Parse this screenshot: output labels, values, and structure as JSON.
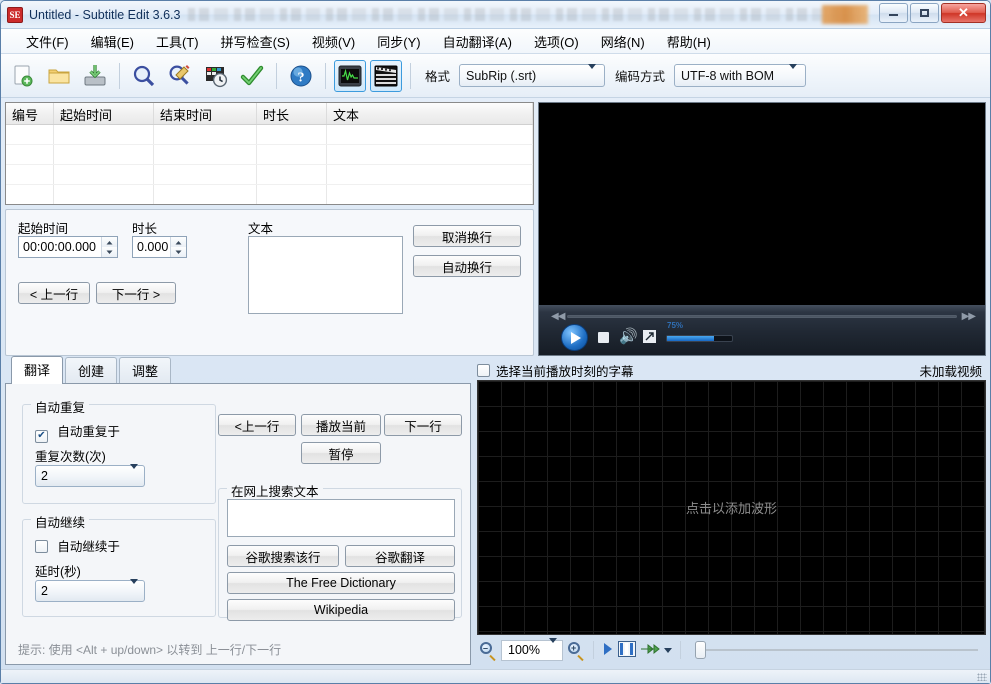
{
  "window": {
    "title": "Untitled - Subtitle Edit 3.6.3",
    "app_icon": "subtitle-edit-icon",
    "minimize": "–",
    "maximize": "□",
    "close": "✕"
  },
  "menu": [
    {
      "label": "文件(F)",
      "text": "文件",
      "key": "F"
    },
    {
      "label": "编辑(E)",
      "text": "编辑",
      "key": "E"
    },
    {
      "label": "工具(T)",
      "text": "工具",
      "key": "T"
    },
    {
      "label": "拼写检查(S)",
      "text": "拼写检查",
      "key": "S"
    },
    {
      "label": "视频(V)",
      "text": "视频",
      "key": "V"
    },
    {
      "label": "同步(Y)",
      "text": "同步",
      "key": "Y"
    },
    {
      "label": "自动翻译(A)",
      "text": "自动翻译",
      "key": "A"
    },
    {
      "label": "选项(O)",
      "text": "选项",
      "key": "O"
    },
    {
      "label": "网络(N)",
      "text": "网络",
      "key": "N"
    },
    {
      "label": "帮助(H)",
      "text": "帮助",
      "key": "H"
    }
  ],
  "toolbar": {
    "icons": [
      "new-file-icon",
      "open-folder-icon",
      "save-icon",
      "find-icon",
      "replace-icon",
      "sync-time-icon",
      "spell-check-icon",
      "help-icon",
      "waveform-toggle-icon",
      "video-toggle-icon"
    ],
    "format_label": "格式",
    "format_value": "SubRip (.srt)",
    "encoding_label": "编码方式",
    "encoding_value": "UTF-8 with BOM"
  },
  "list_view": {
    "columns": [
      "编号",
      "起始时间",
      "结束时间",
      "时长",
      "文本"
    ],
    "rows": []
  },
  "edit_panel": {
    "start_time_label": "起始时间",
    "start_time_value": "00:00:00.000",
    "duration_label": "时长",
    "duration_value": "0.000",
    "text_label": "文本",
    "text_value": "",
    "unbreak_button": "取消换行",
    "autobreak_button": "自动换行",
    "prev_button": "< 上一行",
    "next_button": "下一行 >"
  },
  "video": {
    "play_icon": "play-icon",
    "stop_icon": "stop-icon",
    "volume_icon": "volume-icon",
    "fullscreen_icon": "fullscreen-icon",
    "rewind_icon": "rewind-icon",
    "forward_icon": "fast-forward-icon",
    "volume_percent": "75%"
  },
  "tabs": [
    {
      "label": "翻译",
      "active": true
    },
    {
      "label": "创建",
      "active": false
    },
    {
      "label": "调整",
      "active": false
    }
  ],
  "translate_tab": {
    "auto_repeat": {
      "group_title": "自动重复",
      "checkbox_label": "自动重复于",
      "checked": true,
      "count_label": "重复次数(次)",
      "count_value": "2"
    },
    "auto_continue": {
      "group_title": "自动继续",
      "checkbox_label": "自动继续于",
      "checked": false,
      "delay_label": "延时(秒)",
      "delay_value": "2"
    },
    "nav_buttons": {
      "prev": "<上一行",
      "play_current": "播放当前",
      "next": "下一行",
      "pause": "暂停"
    },
    "search": {
      "group_title": "在网上搜索文本",
      "input_value": "",
      "google_search_line": "谷歌搜索该行",
      "google_translate": "谷歌翻译",
      "free_dictionary": "The Free Dictionary",
      "wikipedia": "Wikipedia"
    },
    "hint": "提示: 使用 <Alt + up/down> 以转到 上一行/下一行"
  },
  "waveform": {
    "select_current_label": "选择当前播放时刻的字幕",
    "select_current_checked": false,
    "status_right": "未加载视频",
    "placeholder": "点击以添加波形",
    "zoom_out_icon": "zoom-out-icon",
    "zoom_value": "100%",
    "zoom_in_icon": "zoom-in-icon",
    "play_icon": "play-icon",
    "scene_change_icon": "scene-change-icon",
    "fast-forward_icon": "fast-forward-icon"
  },
  "colors": {
    "accent": "#3c9bdd",
    "title_text": "#11305a",
    "close_button": "#cf3526",
    "waveform_bg": "#000000",
    "selection": "#cde3f7"
  }
}
